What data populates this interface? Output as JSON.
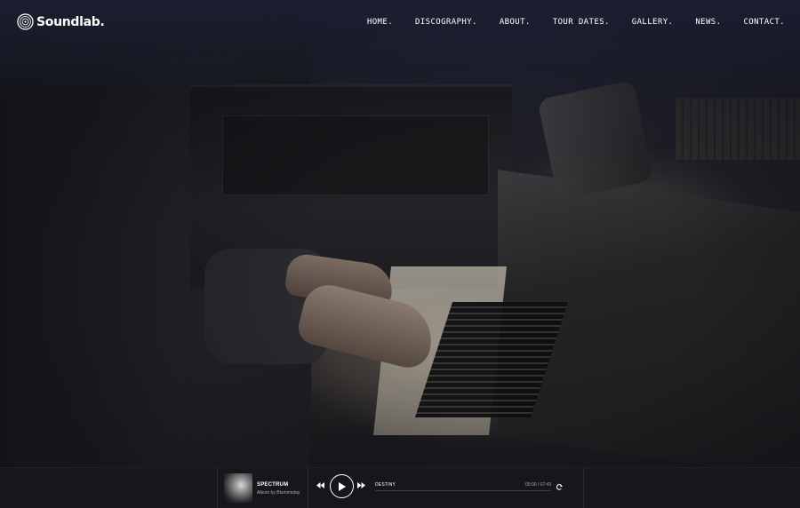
{
  "brand": {
    "name": "Soundlab."
  },
  "nav": {
    "items": [
      "HOME.",
      "DISCOGRAPHY.",
      "ABOUT.",
      "TOUR DATES.",
      "GALLERY.",
      "NEWS.",
      "CONTACT."
    ]
  },
  "hero": {
    "image": "piano-player-photo"
  },
  "player": {
    "album_title": "SPECTRUM",
    "album_sub": "Album by Blummsday",
    "track_name": "DESTINY",
    "time": "00:00 / 07:43",
    "progress": 0,
    "icons": [
      "rewind-icon",
      "play-icon",
      "fast-forward-icon",
      "repeat-icon"
    ]
  },
  "colors": {
    "header_tint": "#1c2034",
    "player_bg": "#16171d",
    "text": "#ffffff",
    "muted": "#a8a9b2"
  }
}
